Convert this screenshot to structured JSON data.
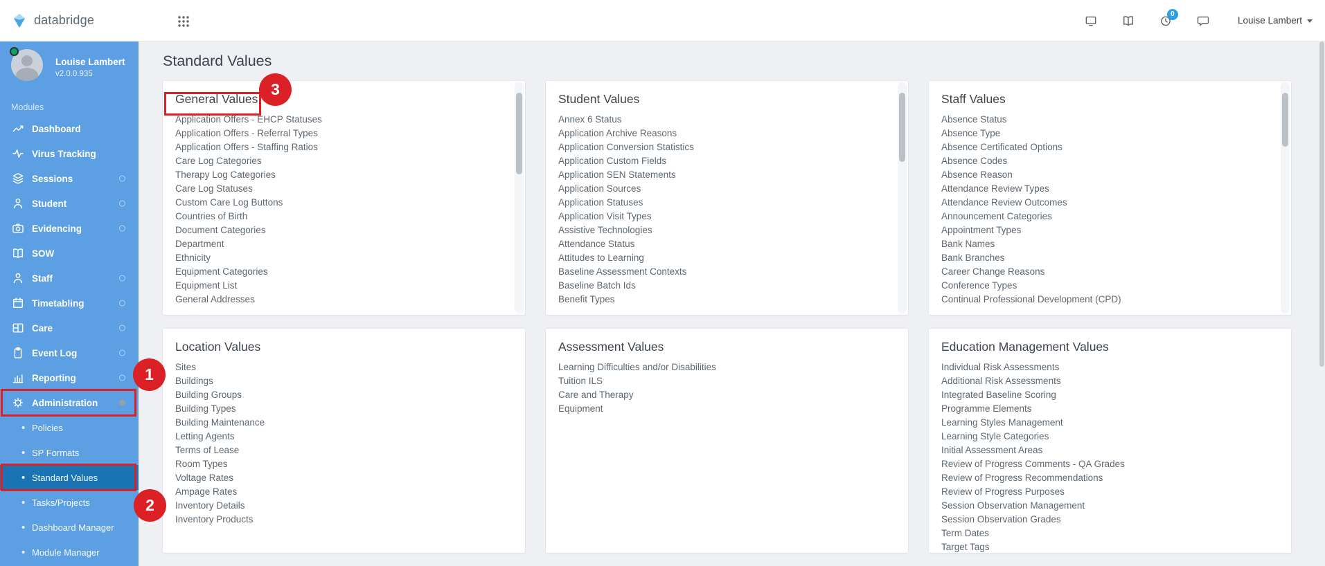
{
  "topbar": {
    "brand": "databridge",
    "user_menu_label": "Louise Lambert",
    "notification_badge": "0",
    "icons": [
      "grid-icon",
      "monitor-icon",
      "book-icon",
      "clock-icon",
      "chat-icon"
    ]
  },
  "sidebar": {
    "user": {
      "name": "Louise Lambert",
      "version": "v2.0.0.935"
    },
    "section_label": "Modules",
    "modules": [
      {
        "label": "Dashboard",
        "icon": "chart-line",
        "indicator": ""
      },
      {
        "label": "Virus Tracking",
        "icon": "activity",
        "indicator": ""
      },
      {
        "label": "Sessions",
        "icon": "layers",
        "indicator": "ring"
      },
      {
        "label": "Student",
        "icon": "user",
        "indicator": "ring"
      },
      {
        "label": "Evidencing",
        "icon": "camera",
        "indicator": "ring"
      },
      {
        "label": "SOW",
        "icon": "book-open",
        "indicator": ""
      },
      {
        "label": "Staff",
        "icon": "user",
        "indicator": "ring"
      },
      {
        "label": "Timetabling",
        "icon": "calendar",
        "indicator": "ring"
      },
      {
        "label": "Care",
        "icon": "window",
        "indicator": "ring"
      },
      {
        "label": "Event Log",
        "icon": "clipboard",
        "indicator": "ring"
      },
      {
        "label": "Reporting",
        "icon": "bar-chart",
        "indicator": "ring"
      },
      {
        "label": "Administration",
        "icon": "gear",
        "indicator": "dot",
        "annotated": true
      }
    ],
    "admin_children": [
      {
        "label": "Policies"
      },
      {
        "label": "SP Formats"
      },
      {
        "label": "Standard Values",
        "selected": true,
        "annotated": true
      },
      {
        "label": "Tasks/Projects"
      },
      {
        "label": "Dashboard Manager"
      },
      {
        "label": "Module Manager"
      }
    ]
  },
  "main": {
    "page_title": "Standard Values",
    "cards": [
      {
        "title": "General Values",
        "annotated": true,
        "scrollbar": true,
        "thumb_height": 118,
        "items": [
          "Application Offers - EHCP Statuses",
          "Application Offers - Referral Types",
          "Application Offers - Staffing Ratios",
          "Care Log Categories",
          "Therapy Log Categories",
          "Care Log Statuses",
          "Custom Care Log Buttons",
          "Countries of Birth",
          "Document Categories",
          "Department",
          "Ethnicity",
          "Equipment Categories",
          "Equipment List",
          "General Addresses"
        ]
      },
      {
        "title": "Student Values",
        "scrollbar": true,
        "thumb_height": 100,
        "items": [
          "Annex 6 Status",
          "Application Archive Reasons",
          "Application Conversion Statistics",
          "Application Custom Fields",
          "Application SEN Statements",
          "Application Sources",
          "Application Statuses",
          "Application Visit Types",
          "Assistive Technologies",
          "Attendance Status",
          "Attitudes to Learning",
          "Baseline Assessment Contexts",
          "Baseline Batch Ids",
          "Benefit Types"
        ]
      },
      {
        "title": "Staff Values",
        "scrollbar": true,
        "thumb_height": 78,
        "items": [
          "Absence Status",
          "Absence Type",
          "Absence Certificated Options",
          "Absence Codes",
          "Absence Reason",
          "Attendance Review Types",
          "Attendance Review Outcomes",
          "Announcement Categories",
          "Appointment Types",
          "Bank Names",
          "Bank Branches",
          "Career Change Reasons",
          "Conference Types",
          "Continual Professional Development (CPD)"
        ]
      },
      {
        "title": "Location Values",
        "scrollbar": false,
        "items": [
          "Sites",
          "Buildings",
          "Building Groups",
          "Building Types",
          "Building Maintenance",
          "Letting Agents",
          "Terms of Lease",
          "Room Types",
          "Voltage Rates",
          "Ampage Rates",
          "Inventory Details",
          "Inventory Products"
        ]
      },
      {
        "title": "Assessment Values",
        "scrollbar": false,
        "items": [
          "Learning Difficulties and/or Disabilities",
          "Tuition ILS",
          "Care and Therapy",
          "Equipment"
        ]
      },
      {
        "title": "Education Management Values",
        "scrollbar": false,
        "items": [
          "Individual Risk Assessments",
          "Additional Risk Assessments",
          "Integrated Baseline Scoring",
          "Programme Elements",
          "Learning Styles Management",
          "Learning Style Categories",
          "Initial Assessment Areas",
          "Review of Progress Comments - QA Grades",
          "Review of Progress Recommendations",
          "Review of Progress Purposes",
          "Session Observation Management",
          "Session Observation Grades",
          "Term Dates",
          "Target Tags"
        ]
      }
    ]
  },
  "annotations": {
    "steps": [
      {
        "label": "1"
      },
      {
        "label": "2"
      },
      {
        "label": "3"
      }
    ]
  },
  "colors": {
    "sidebar_blue": "#5C9FE2",
    "selected_blue": "#1A73B2",
    "annotation_red": "#DB2026",
    "badge_blue": "#2B9FE8",
    "status_green": "#12A05E"
  }
}
